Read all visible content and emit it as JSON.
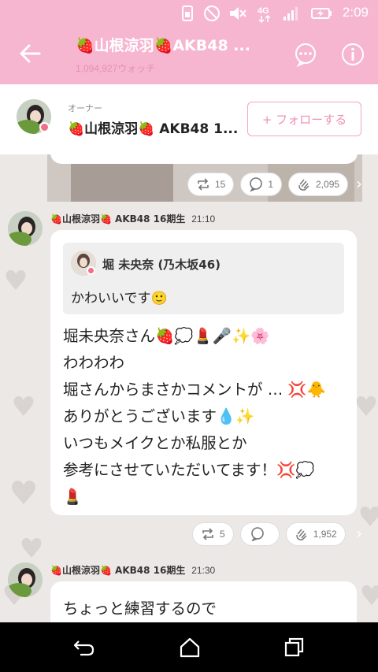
{
  "status_bar": {
    "time": "2:09",
    "icons": [
      "sim-icon",
      "dnd-icon",
      "mute-icon",
      "4g-icon",
      "signal-icon",
      "battery-charging-icon"
    ]
  },
  "header": {
    "title": "🍓山根涼羽🍓AKB48 ...",
    "subtitle": "1,094,927ウォッチ",
    "accent": "#f6b6cf"
  },
  "owner": {
    "label": "オーナー",
    "name": "🍓山根涼羽🍓 AKB48 1...",
    "follow_label": "+ フォローする"
  },
  "posts": [
    {
      "reactions": {
        "repost": "15",
        "comment": "1",
        "clap": "2,095"
      }
    },
    {
      "author": "🍓山根涼羽🍓 AKB48 16期生",
      "time": "21:10",
      "quote": {
        "author": "堀 未央奈 (乃木坂46)",
        "text": "かわいいです🙂"
      },
      "lines": [
        "堀未央奈さん🍓💭💄🎤✨🌸",
        "わわわわ",
        "堀さんからまさかコメントが … 💢🐥",
        "ありがとうございます💧✨",
        "いつもメイクとか私服とか",
        "参考にさせていただいてます！💢💭",
        "💄"
      ],
      "reactions": {
        "repost": "5",
        "comment": "",
        "clap": "1,952"
      }
    },
    {
      "author": "🍓山根涼羽🍓 AKB48 16期生",
      "time": "21:30",
      "text": "ちょっと練習するので"
    }
  ],
  "navbar": {
    "buttons": [
      "back-nav-icon",
      "home-nav-icon",
      "recents-nav-icon"
    ]
  }
}
